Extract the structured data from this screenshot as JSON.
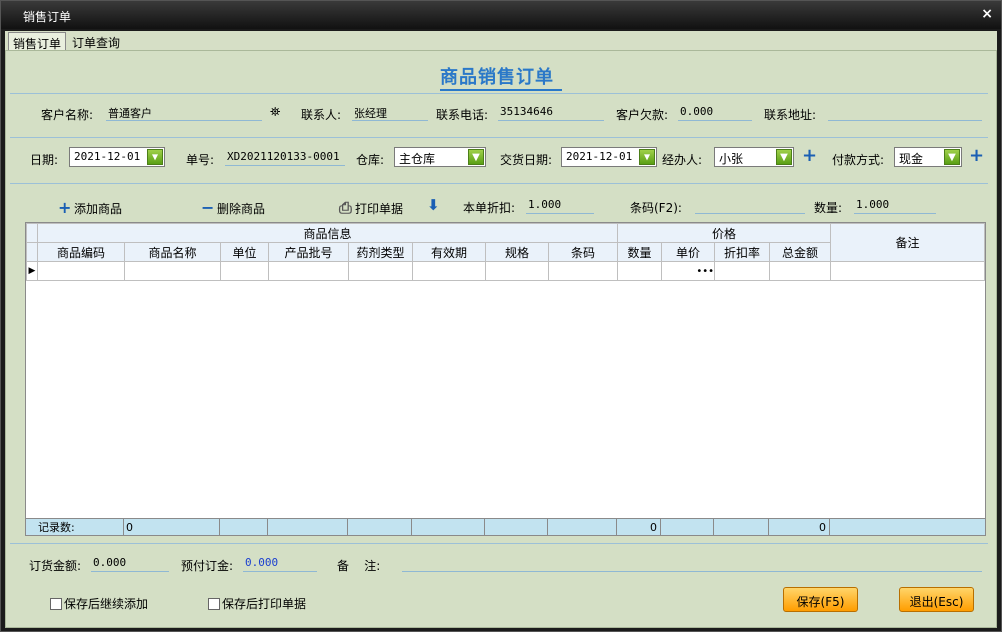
{
  "window": {
    "title": "销售订单",
    "close": "×"
  },
  "tabs": [
    "销售订单",
    "订单查询"
  ],
  "heading": "商品销售订单",
  "customer": {
    "name_label": "客户名称:",
    "name_value": "普通客户",
    "contact_label": "联系人:",
    "contact_value": "张经理",
    "phone_label": "联系电话:",
    "phone_value": "35134646",
    "debt_label": "客户欠款:",
    "debt_value": "0.000",
    "address_label": "联系地址:",
    "address_value": ""
  },
  "order": {
    "date_label": "日期:",
    "date_value": "2021-12-01",
    "no_label": "单号:",
    "no_value": "XD2021120133-0001",
    "warehouse_label": "仓库:",
    "warehouse_value": "主仓库",
    "delivery_label": "交货日期:",
    "delivery_value": "2021-12-01",
    "handler_label": "经办人:",
    "handler_value": "小张",
    "payment_label": "付款方式:",
    "payment_value": "现金"
  },
  "toolbar": {
    "add": "添加商品",
    "delete": "删除商品",
    "print": "打印单据",
    "discount_label": "本单折扣:",
    "discount_value": "1.000",
    "barcode_label": "条码(F2):",
    "barcode_value": "",
    "qty_label": "数量:",
    "qty_value": "1.000"
  },
  "grid": {
    "group_info": "商品信息",
    "group_price": "价格",
    "remark": "备注",
    "columns": [
      "商品编码",
      "商品名称",
      "单位",
      "产品批号",
      "药剂类型",
      "有效期",
      "规格",
      "条码",
      "数量",
      "单价",
      "折扣率",
      "总金额"
    ],
    "footer_label": "记录数:",
    "footer_count": "0",
    "footer_qty": "0",
    "footer_total": "0"
  },
  "bottom": {
    "amount_label": "订货金额:",
    "amount_value": "0.000",
    "prepay_label": "预付订金:",
    "prepay_value": "0.000",
    "remark_label": "备    注:",
    "remark_value": "",
    "chk_continue": "保存后继续添加",
    "chk_print": "保存后打印单据",
    "save": "保存(F5)",
    "exit": "退出(Esc)"
  },
  "colors": {
    "panel": "#d4dfc5",
    "accent": "#2a78c8",
    "button": "#ffb020"
  }
}
